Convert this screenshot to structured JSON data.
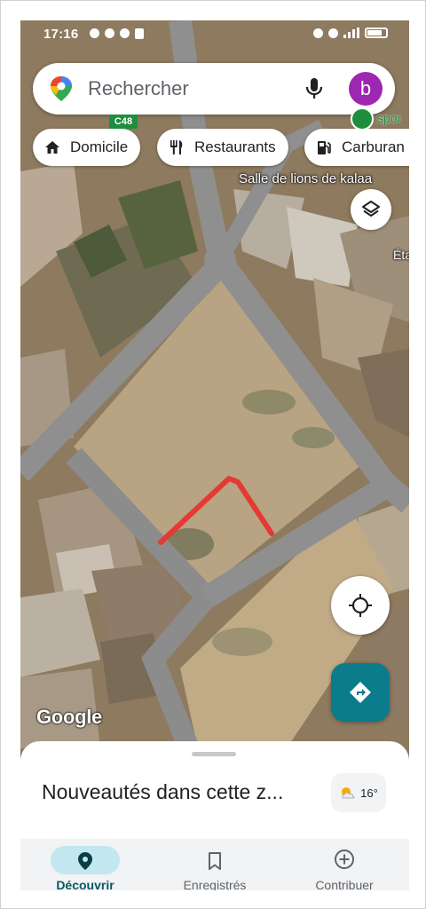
{
  "status_bar": {
    "time": "17:16"
  },
  "search": {
    "placeholder": "Rechercher",
    "avatar_letter": "b"
  },
  "chips": [
    {
      "label": "Domicile",
      "icon": "home-icon"
    },
    {
      "label": "Restaurants",
      "icon": "restaurant-icon"
    },
    {
      "label": "Carburan",
      "icon": "gas-station-icon"
    }
  ],
  "map": {
    "road_shield": "C48",
    "poi_partial_label": "spor",
    "place_label": "Salle de lions de kalaa",
    "edge_label": "Éta",
    "watermark": "Google",
    "drawn_line_color": "#e53935"
  },
  "sheet": {
    "title": "Nouveautés dans cette z...",
    "weather_temp": "16°"
  },
  "nav": [
    {
      "label": "Découvrir",
      "icon": "explore-pin-icon",
      "active": true
    },
    {
      "label": "Enregistrés",
      "icon": "bookmark-icon",
      "active": false
    },
    {
      "label": "Contribuer",
      "icon": "add-circle-icon",
      "active": false
    }
  ],
  "colors": {
    "accent": "#0b7c8c",
    "avatar": "#9c27b0",
    "poi": "#1e8e3e"
  }
}
